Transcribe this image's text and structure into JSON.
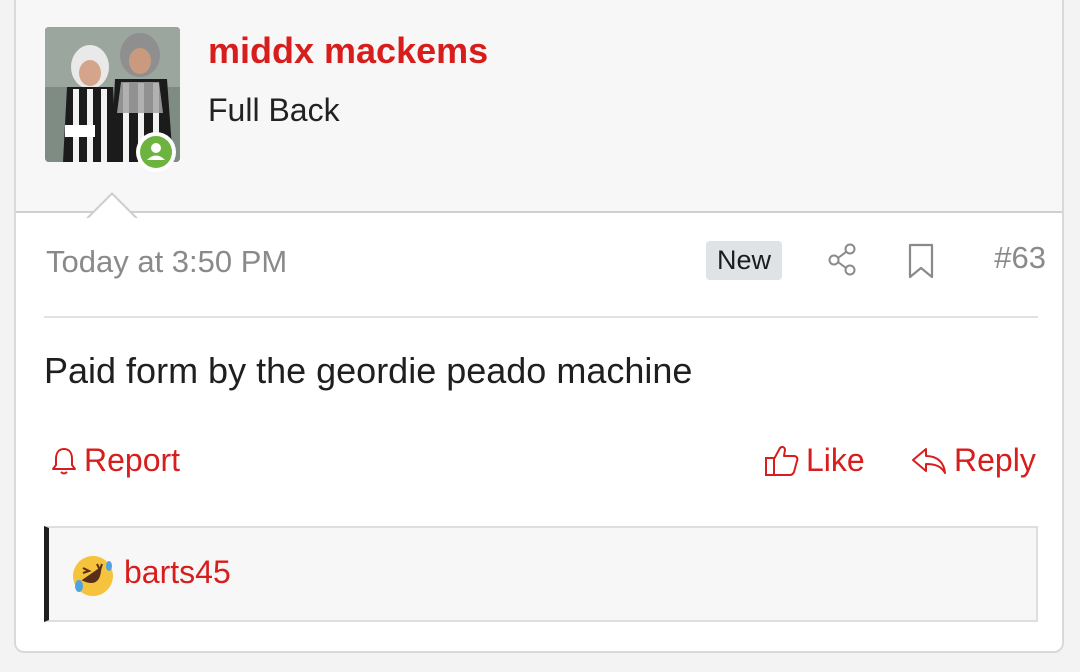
{
  "post": {
    "username": "middx mackems",
    "user_title": "Full Back",
    "timestamp": "Today at 3:50 PM",
    "badge": "New",
    "post_number": "#63",
    "message": "Paid form by the geordie peado machine"
  },
  "actions": {
    "report": "Report",
    "like": "Like",
    "reply": "Reply"
  },
  "reactions": {
    "users": "barts45",
    "emoji": "rolling-on-floor-laughing"
  },
  "colors": {
    "accent": "#d81d1d",
    "online": "#6db33f",
    "badge_bg": "#dfe3e6"
  }
}
